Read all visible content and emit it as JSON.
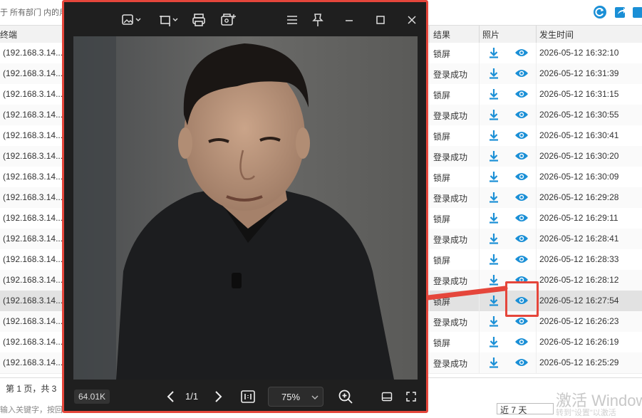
{
  "filter_text": "于 所有部门 内的用",
  "columns": {
    "terminal": "终端",
    "result": "结果",
    "photo": "照片",
    "time": "发生时间"
  },
  "rows": [
    {
      "terminal": "(192.168.3.14...",
      "result": "锁屏",
      "time": "2026-05-12 16:32:10"
    },
    {
      "terminal": "(192.168.3.14...",
      "result": "登录成功",
      "time": "2026-05-12 16:31:39"
    },
    {
      "terminal": "(192.168.3.14...",
      "result": "锁屏",
      "time": "2026-05-12 16:31:15"
    },
    {
      "terminal": "(192.168.3.14...",
      "result": "登录成功",
      "time": "2026-05-12 16:30:55"
    },
    {
      "terminal": "(192.168.3.14...",
      "result": "锁屏",
      "time": "2026-05-12 16:30:41"
    },
    {
      "terminal": "(192.168.3.14...",
      "result": "登录成功",
      "time": "2026-05-12 16:30:20"
    },
    {
      "terminal": "(192.168.3.14...",
      "result": "锁屏",
      "time": "2026-05-12 16:30:09"
    },
    {
      "terminal": "(192.168.3.14...",
      "result": "登录成功",
      "time": "2026-05-12 16:29:28"
    },
    {
      "terminal": "(192.168.3.14...",
      "result": "锁屏",
      "time": "2026-05-12 16:29:11"
    },
    {
      "terminal": "(192.168.3.14...",
      "result": "登录成功",
      "time": "2026-05-12 16:28:41"
    },
    {
      "terminal": "(192.168.3.14...",
      "result": "锁屏",
      "time": "2026-05-12 16:28:33"
    },
    {
      "terminal": "(192.168.3.14...",
      "result": "登录成功",
      "time": "2026-05-12 16:28:12"
    },
    {
      "terminal": "(192.168.3.14...",
      "result": "锁屏",
      "time": "2026-05-12 16:27:54"
    },
    {
      "terminal": "(192.168.3.14...",
      "result": "登录成功",
      "time": "2026-05-12 16:26:23"
    },
    {
      "terminal": "(192.168.3.14...",
      "result": "锁屏",
      "time": "2026-05-12 16:26:19"
    },
    {
      "terminal": "(192.168.3.14...",
      "result": "登录成功",
      "time": "2026-05-12 16:25:29"
    }
  ],
  "selected_row": 12,
  "footer": {
    "page_info": "第 1 页，共 3",
    "search_hint": "输入关键字，按回",
    "day_range": "近 7 天"
  },
  "watermark": {
    "line1": "激活 Windows",
    "line2": "转到\"设置\"以激活"
  },
  "viewer": {
    "file_size": "64.01K",
    "page_indicator": "1/1",
    "zoom": "75%"
  },
  "colors": {
    "accent_blue": "#1a8fd6",
    "callout_red": "#e5463b",
    "viewer_bg": "#1f1f1f"
  },
  "icons": {
    "toolbar": [
      "refresh-icon",
      "share-icon",
      "export-icon"
    ],
    "viewer_top": [
      "edit-image-icon",
      "rotate-icon",
      "print-icon",
      "image-tools-icon",
      "menu-icon",
      "pin-icon",
      "minimize-icon",
      "maximize-icon",
      "close-icon"
    ],
    "row": [
      "download-icon",
      "eye-icon"
    ]
  }
}
